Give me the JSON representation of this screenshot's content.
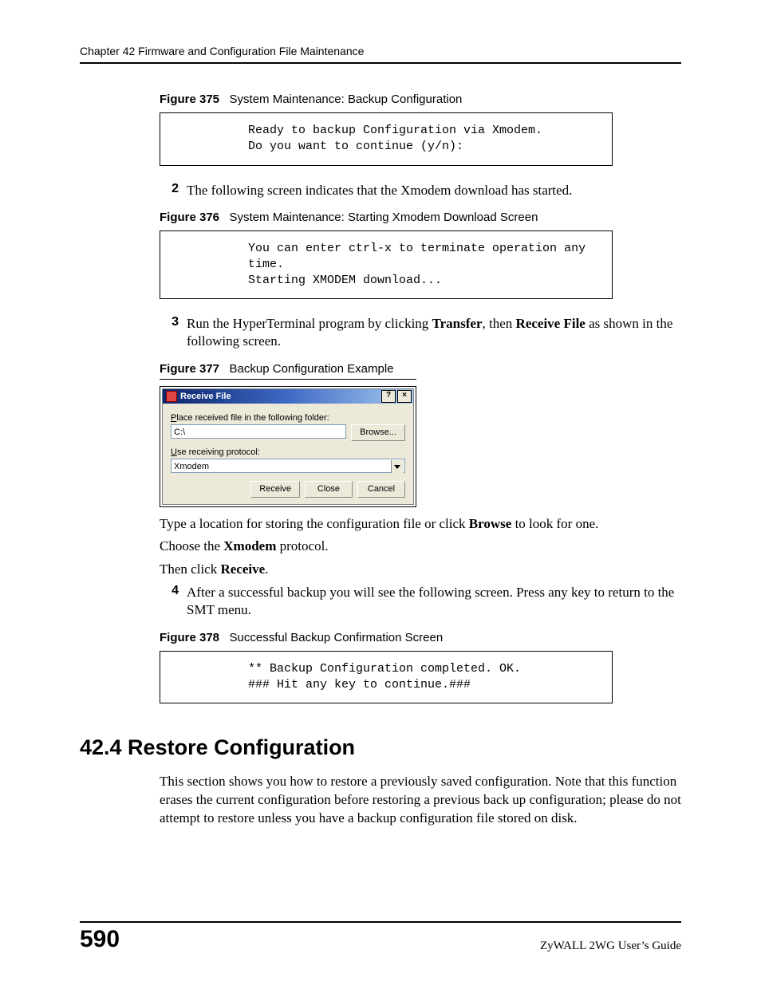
{
  "header": {
    "running": "Chapter 42 Firmware and Configuration File Maintenance"
  },
  "fig375": {
    "label": "Figure 375",
    "title": "System Maintenance: Backup Configuration",
    "code": "Ready to backup Configuration via Xmodem.\nDo you want to continue (y/n):"
  },
  "step2": {
    "num": "2",
    "text": "The following screen indicates that the Xmodem download has started."
  },
  "fig376": {
    "label": "Figure 376",
    "title": "System Maintenance: Starting Xmodem Download Screen",
    "code": "You can enter ctrl-x to terminate operation any time.\nStarting XMODEM download..."
  },
  "step3": {
    "num": "3",
    "text_pre": "Run the HyperTerminal program by clicking ",
    "bold1": "Transfer",
    "mid": ", then ",
    "bold2": "Receive File",
    "post": " as shown in the following screen."
  },
  "fig377": {
    "label": "Figure 377",
    "title": "Backup Configuration Example"
  },
  "dialog": {
    "title": "Receive File",
    "help": "?",
    "close": "×",
    "label_folder_u": "P",
    "label_folder_rest": "lace received file in the following folder:",
    "folder_value": "C:\\",
    "browse_u": "B",
    "browse_rest": "rowse...",
    "label_proto_u": "U",
    "label_proto_rest": "se receiving protocol:",
    "proto_value": "Xmodem",
    "receive_u": "R",
    "receive_rest": "eceive",
    "close_btn_u": "C",
    "close_btn_rest": "lose",
    "cancel": "Cancel"
  },
  "para_type": {
    "pre": "Type a location for storing the configuration file or click ",
    "bold": "Browse",
    "post": " to look for one."
  },
  "para_choose": {
    "pre": "Choose the ",
    "bold": "Xmodem",
    "post": " protocol."
  },
  "para_then": {
    "pre": "Then click ",
    "bold": "Receive",
    "post": "."
  },
  "step4": {
    "num": "4",
    "text": "After a successful backup you will see the following screen. Press any key to return to the SMT menu."
  },
  "fig378": {
    "label": "Figure 378",
    "title": "Successful Backup Confirmation Screen",
    "code": "** Backup Configuration completed. OK.\n### Hit any key to continue.###"
  },
  "section": {
    "heading": "42.4  Restore Configuration",
    "para": "This section shows you how to restore a previously saved configuration. Note that this function erases the current configuration before restoring a previous back up configuration; please do not attempt to restore unless you have a backup configuration file stored on disk."
  },
  "footer": {
    "page": "590",
    "guide": "ZyWALL 2WG User’s Guide"
  }
}
